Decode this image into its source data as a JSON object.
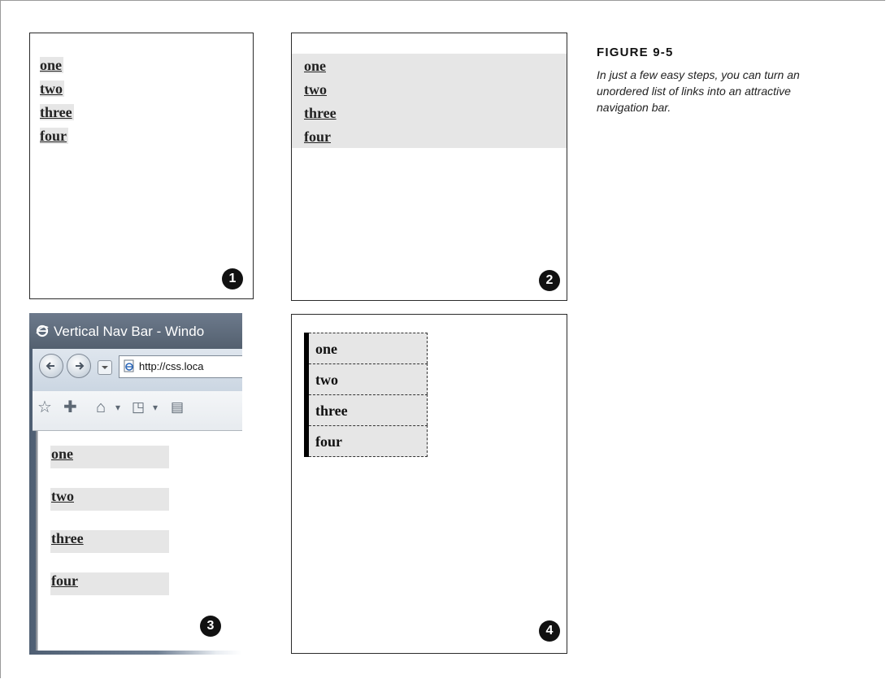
{
  "figure": {
    "title": "FIGURE 9-5",
    "caption": "In just a few easy steps, you can turn an unordered list of links into an attractive navigation bar."
  },
  "panels": {
    "p1": {
      "step": "1",
      "links": [
        "one",
        "two",
        "three",
        "four"
      ]
    },
    "p2": {
      "step": "2",
      "links": [
        "one",
        "two",
        "three",
        "four"
      ]
    },
    "p3": {
      "step": "3",
      "window_title": "Vertical Nav Bar - Windo",
      "address": "http://css.loca",
      "links": [
        "one",
        "two",
        "three",
        "four"
      ]
    },
    "p4": {
      "step": "4",
      "links": [
        "one",
        "two",
        "three",
        "four"
      ]
    }
  },
  "icons": {
    "badge": "circled-number",
    "back": "back-arrow-icon",
    "forward": "forward-arrow-icon",
    "browser": "ie-logo-icon",
    "favorites": "star-icon",
    "add_favorites": "plus-icon",
    "home": "home-icon",
    "feeds": "rss-icon"
  },
  "colors": {
    "link_bg": "#e6e6e6",
    "nav_border": "#000000"
  }
}
